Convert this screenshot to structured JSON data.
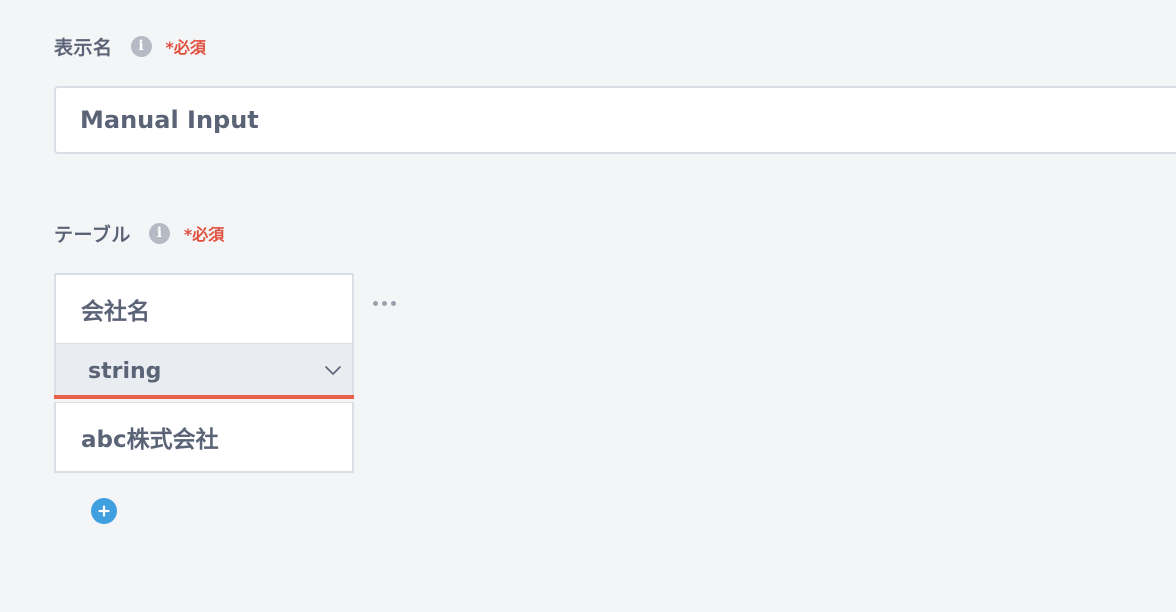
{
  "display_name": {
    "label": "表示名",
    "info_icon_glyph": "i",
    "required": "*必須",
    "value": "Manual Input"
  },
  "table": {
    "label": "テーブル",
    "info_icon_glyph": "i",
    "required": "*必須",
    "columns": [
      {
        "header": "会社名",
        "type": "string",
        "value": "abc株式会社"
      }
    ]
  },
  "icons": {
    "info": "info-icon",
    "chevron": "chevron-down-icon",
    "more": "more-horizontal-icon",
    "add": "plus-circle-icon"
  },
  "colors": {
    "background": "#f4f5f7",
    "text": "#5b6477",
    "required": "#e0503f",
    "accent_underline": "#e8614b",
    "add_button": "#3f9fdf",
    "info_icon": "#b5bac4"
  }
}
